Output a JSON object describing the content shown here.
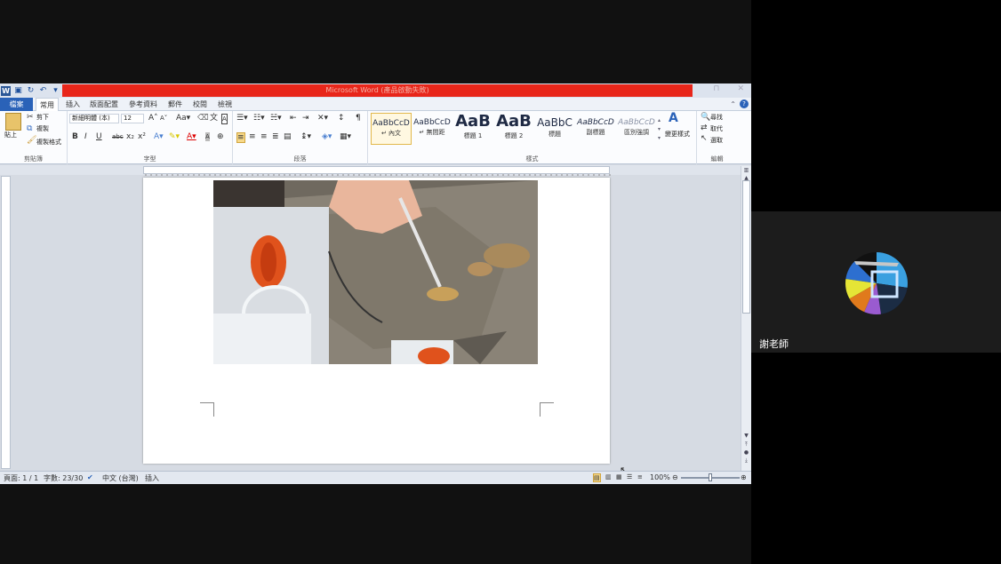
{
  "window": {
    "title": "Microsoft Word (產品啟動失敗)",
    "controls": [
      "⊓",
      "✕"
    ]
  },
  "tabs": {
    "file": "檔案",
    "items": [
      "常用",
      "插入",
      "版面配置",
      "參考資料",
      "郵件",
      "校閱",
      "檢視"
    ]
  },
  "ribbon": {
    "clipboard": {
      "label": "剪貼簿",
      "paste": "貼上",
      "cut": "剪下",
      "copy": "複製",
      "format_painter": "複製格式"
    },
    "font": {
      "label": "字型",
      "font_name": "新細明體 (本)",
      "font_size": "12",
      "bold": "B",
      "italic": "I",
      "underline": "U",
      "strike": "abc",
      "sub": "x₂",
      "sup": "x²"
    },
    "paragraph": {
      "label": "段落"
    },
    "styles": {
      "label": "樣式",
      "items": [
        {
          "sample": "AaBbCcD",
          "name": "↵ 內文"
        },
        {
          "sample": "AaBbCcD",
          "name": "↵ 無間距"
        },
        {
          "sample": "AaB",
          "name": "標題 1"
        },
        {
          "sample": "AaB",
          "name": "標題 2"
        },
        {
          "sample": "AaBbC",
          "name": "標題"
        },
        {
          "sample": "AaBbCcD",
          "name": "副標題"
        },
        {
          "sample": "AaBbCcD",
          "name": "區別強調"
        }
      ],
      "change_styles": "變更樣式"
    },
    "editing": {
      "label": "編輯",
      "find": "尋找",
      "replace": "取代",
      "select": "選取"
    }
  },
  "statusbar": {
    "page": "頁面: 1 / 1",
    "words": "字數: 23/30",
    "language": "中文 (台灣)",
    "mode": "插入",
    "zoom": "100%"
  },
  "participant": {
    "name": "謝老師"
  }
}
